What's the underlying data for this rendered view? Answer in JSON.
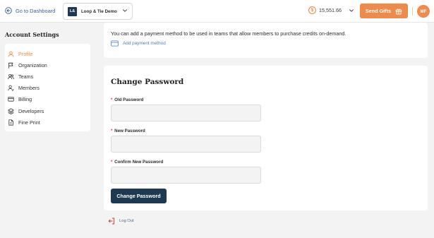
{
  "header": {
    "back_label": "Go to Dashboard",
    "workspace": {
      "logo_text": "L&",
      "name": "Loop & Tie Demo"
    },
    "credits": {
      "value": "15,551.66",
      "coin_symbol": "$"
    },
    "send_gifts_label": "Send Gifts",
    "avatar_initials": "MF"
  },
  "sidebar": {
    "heading": "Account Settings",
    "items": [
      {
        "label": "Profile",
        "icon": "person-icon",
        "active": true
      },
      {
        "label": "Organization",
        "icon": "flag-icon",
        "active": false
      },
      {
        "label": "Teams",
        "icon": "team-icon",
        "active": false
      },
      {
        "label": "Members",
        "icon": "members-icon",
        "active": false
      },
      {
        "label": "Billing",
        "icon": "credit-card-icon",
        "active": false
      },
      {
        "label": "Developers",
        "icon": "layers-icon",
        "active": false
      },
      {
        "label": "Fine Print",
        "icon": "document-icon",
        "active": false
      }
    ]
  },
  "payment": {
    "description": "You can add a payment method to be used in teams that allow members to purchase credits on-demand.",
    "add_label": "Add payment method"
  },
  "change_password": {
    "title": "Change Password",
    "required_marker": "*",
    "old_label": "Old Password",
    "new_label": "New Password",
    "confirm_label": "Confirm New Password",
    "old_value": "",
    "new_value": "",
    "confirm_value": "",
    "submit_label": "Change Password"
  },
  "logout_label": "Log Out",
  "colors": {
    "accent": "#f08a4b",
    "primary": "#1d3a52",
    "link": "#4a7fb8",
    "background": "#f3f3f3"
  }
}
